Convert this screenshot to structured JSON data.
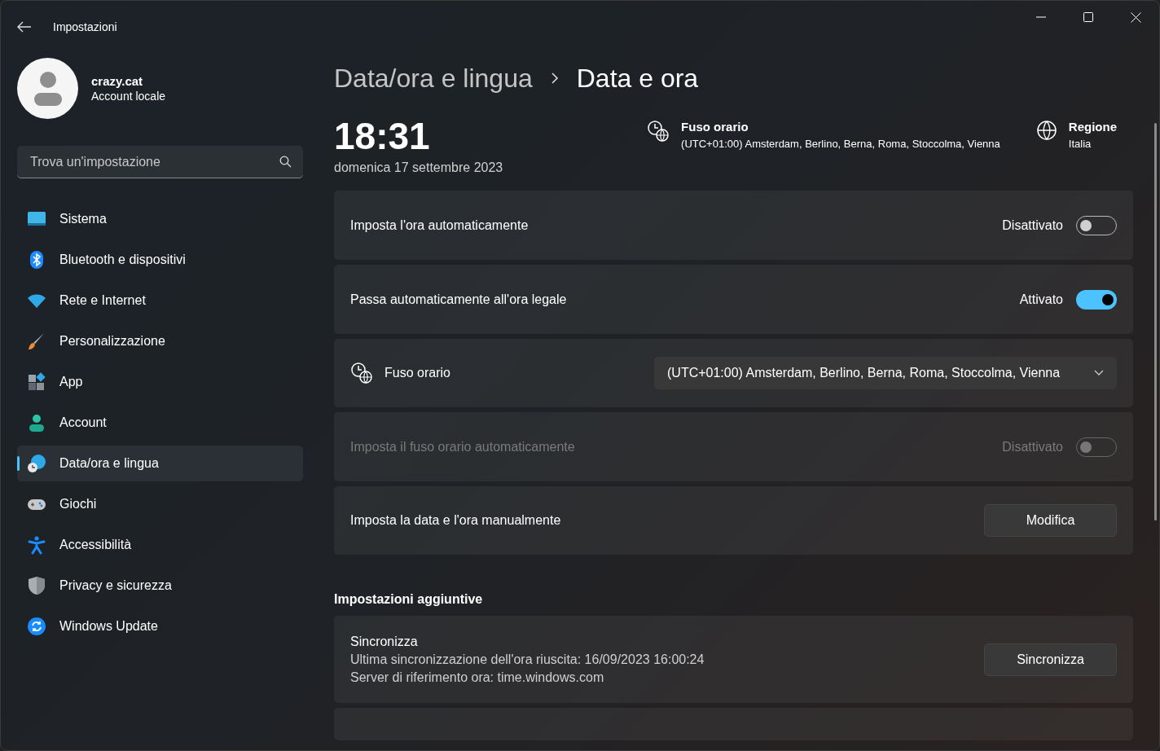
{
  "window": {
    "title": "Impostazioni"
  },
  "user": {
    "name": "crazy.cat",
    "account_type": "Account locale"
  },
  "search": {
    "placeholder": "Trova un'impostazione"
  },
  "sidebar": {
    "items": [
      {
        "label": "Sistema",
        "kind": "system",
        "selected": false
      },
      {
        "label": "Bluetooth e dispositivi",
        "kind": "bluetooth",
        "selected": false
      },
      {
        "label": "Rete e Internet",
        "kind": "network",
        "selected": false
      },
      {
        "label": "Personalizzazione",
        "kind": "brush",
        "selected": false
      },
      {
        "label": "App",
        "kind": "apps",
        "selected": false
      },
      {
        "label": "Account",
        "kind": "account",
        "selected": false
      },
      {
        "label": "Data/ora e lingua",
        "kind": "time-language",
        "selected": true
      },
      {
        "label": "Giochi",
        "kind": "games",
        "selected": false
      },
      {
        "label": "Accessibilità",
        "kind": "accessibility",
        "selected": false
      },
      {
        "label": "Privacy e sicurezza",
        "kind": "privacy",
        "selected": false
      },
      {
        "label": "Windows Update",
        "kind": "update",
        "selected": false
      }
    ]
  },
  "breadcrumb": {
    "parent": "Data/ora e lingua",
    "current": "Data e ora"
  },
  "clock": {
    "time": "18:31",
    "date": "domenica 17 settembre 2023"
  },
  "summary": [
    {
      "kind": "timezone",
      "title": "Fuso orario",
      "value": "(UTC+01:00) Amsterdam, Berlino, Berna, Roma, Stoccolma, Vienna"
    },
    {
      "kind": "globe",
      "title": "Regione",
      "value": "Italia"
    }
  ],
  "settings": [
    {
      "kind": "toggle",
      "label": "Imposta l'ora automaticamente",
      "state_label": "Disattivato",
      "on": false,
      "disabled": false
    },
    {
      "kind": "toggle",
      "label": "Passa automaticamente all'ora legale",
      "state_label": "Attivato",
      "on": true,
      "disabled": false
    },
    {
      "kind": "dropdown",
      "label": "Fuso orario",
      "value": "(UTC+01:00) Amsterdam, Berlino, Berna, Roma, Stoccolma, Vienna"
    },
    {
      "kind": "toggle",
      "label": "Imposta il fuso orario automaticamente",
      "state_label": "Disattivato",
      "on": false,
      "disabled": true
    },
    {
      "kind": "button",
      "label": "Imposta la data e l'ora manualmente",
      "button": "Modifica"
    }
  ],
  "additional": {
    "title": "Impostazioni aggiuntive",
    "items": [
      {
        "kind": "sync",
        "title": "Sincronizza",
        "lines": [
          "Ultima sincronizzazione dell'ora riuscita: 16/09/2023 16:00:24",
          "Server di riferimento ora: time.windows.com"
        ],
        "button": "Sincronizza"
      }
    ]
  }
}
